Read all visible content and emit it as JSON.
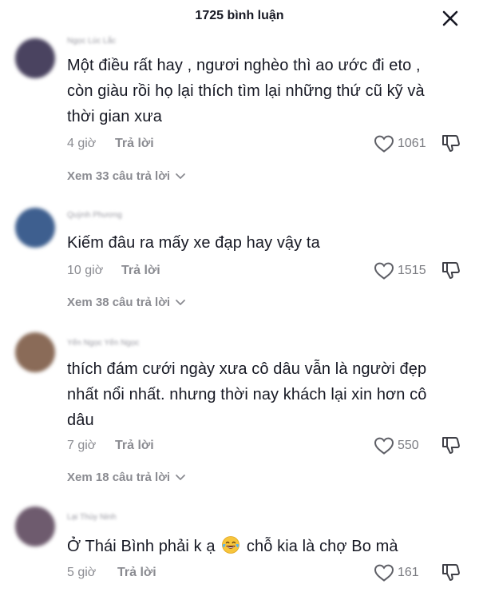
{
  "header": {
    "title": "1725 bình luận",
    "close_icon": "close-icon"
  },
  "comments": [
    {
      "username": "Ngọc Lúc Lắc",
      "text_lines": [
        "Một điều rất hay , ngươi nghèo thì ao ước đi eto ,",
        "còn giàu rồi họ lại thích tìm lại những thứ cũ kỹ và",
        "thời gian xưa"
      ],
      "time": "4 giờ",
      "reply_label": "Trả lời",
      "likes": "1061",
      "view_replies": "Xem 33 câu trả lời",
      "avatar_color": "#4a4360"
    },
    {
      "username": "Quỳnh Phương",
      "text_lines": [
        "Kiếm đâu ra mấy xe đạp hay vậy ta"
      ],
      "time": "10 giờ",
      "reply_label": "Trả lời",
      "likes": "1515",
      "view_replies": "Xem 38 câu trả lời",
      "avatar_color": "#3e5f8f"
    },
    {
      "username": "Yến Ngọc Yến Ngọc",
      "text_lines": [
        "thích đám cưới ngày xưa cô dâu vẫn là người đẹp",
        "nhất nổi nhất. nhưng thời nay khách lại xin hơn cô",
        "dâu"
      ],
      "time": "7 giờ",
      "reply_label": "Trả lời",
      "likes": "550",
      "view_replies": "Xem 18 câu trả lời",
      "avatar_color": "#8a6b58"
    },
    {
      "username": "Lại Thùy Ninh",
      "text_before_emoji": "Ở Thái Bình phải k ạ",
      "text_after_emoji": "chỗ kia là chợ Bo mà",
      "emoji": "face-with-tears-of-joy-emoji",
      "time": "5 giờ",
      "reply_label": "Trả lời",
      "likes": "161",
      "avatar_color": "#6e5b6e"
    }
  ],
  "icons": {
    "like": "heart-outline-icon",
    "dislike": "thumbs-down-icon",
    "expand": "chevron-down-icon"
  },
  "colors": {
    "text": "#161823",
    "secondary": "#8a8b91"
  }
}
